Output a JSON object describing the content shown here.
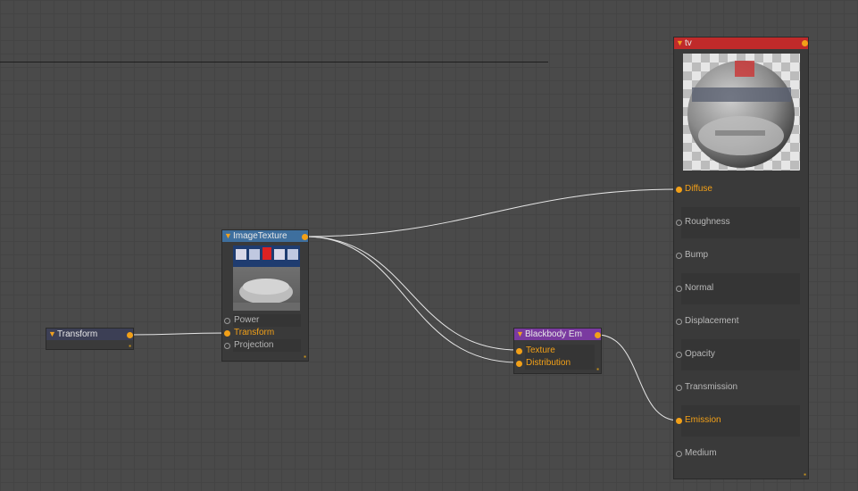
{
  "nodes": {
    "transform": {
      "title": "Transform"
    },
    "image_texture": {
      "title": "ImageTexture",
      "inputs": [
        {
          "label": "Power",
          "connected": false
        },
        {
          "label": "Transform",
          "connected": true
        },
        {
          "label": "Projection",
          "connected": false
        }
      ]
    },
    "blackbody": {
      "title": "Blackbody Em",
      "inputs": [
        {
          "label": "Texture",
          "connected": true
        },
        {
          "label": "Distribution",
          "connected": true
        }
      ]
    },
    "tv": {
      "title": "tv",
      "inputs": [
        {
          "label": "Diffuse",
          "connected": true
        },
        {
          "label": "Roughness",
          "connected": false
        },
        {
          "label": "Bump",
          "connected": false
        },
        {
          "label": "Normal",
          "connected": false
        },
        {
          "label": "Displacement",
          "connected": false
        },
        {
          "label": "Opacity",
          "connected": false
        },
        {
          "label": "Transmission",
          "connected": false
        },
        {
          "label": "Emission",
          "connected": true
        },
        {
          "label": "Medium",
          "connected": false
        }
      ]
    }
  },
  "colors": {
    "background": "#4a4a4a",
    "grid": "#444444",
    "transform_header": "#3c3f55",
    "image_texture_header": "#3e6f9e",
    "blackbody_header": "#7a3aa0",
    "tv_header": "#c02a2a",
    "pin_active": "#f2a018",
    "wire": "#e6e6e6"
  },
  "icons": {
    "collapse": "triangle-down-icon",
    "resize": "resize-grip-icon",
    "pin_connected": "filled-circle-icon",
    "pin_unconnected": "hollow-circle-icon"
  }
}
